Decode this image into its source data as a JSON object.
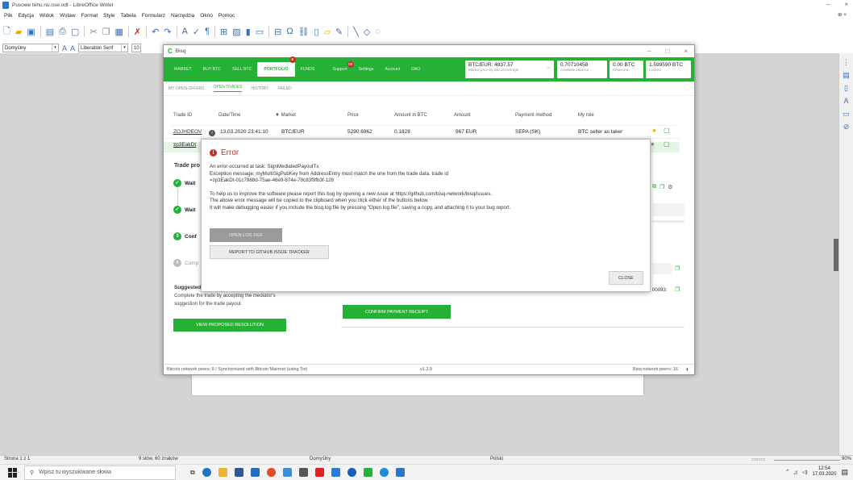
{
  "libreoffice": {
    "title": "Pusowe tehu.nu.ose.odt - LibreOffice Writer",
    "menu": [
      "Plik",
      "Edycja",
      "Widok",
      "Wstaw",
      "Format",
      "Style",
      "Tabela",
      "Formularz",
      "Narzędzia",
      "Okno",
      "Pomoc"
    ],
    "style_combo": "Domyślny",
    "font_combo": "Liberation Serif",
    "size_combo": "10",
    "status": {
      "page": "Strona 1 z 1",
      "words": "9 słów, 60 znaków",
      "style": "Domyślny",
      "lang": "Polski",
      "zoom": "90%"
    }
  },
  "taskbar": {
    "search_placeholder": "Wpisz tu wyszukiwane słowa",
    "time": "12:54",
    "date": "17.03.2020"
  },
  "bisq": {
    "title": "Bisq",
    "nav": [
      {
        "label": "MARKET"
      },
      {
        "label": "BUY BTC"
      },
      {
        "label": "SELL BTC"
      },
      {
        "label": "PORTFOLIO",
        "badge": "6"
      },
      {
        "label": "FUNDS"
      },
      {
        "label": "Support",
        "badge": "58"
      },
      {
        "label": "Settings"
      },
      {
        "label": "Account"
      },
      {
        "label": "DAO"
      }
    ],
    "price": {
      "value": "BTC/EUR: 4837.57",
      "sub": "Market price by BitcoinAverage"
    },
    "balances": [
      {
        "value": "0.70710458",
        "sub": "Available balance"
      },
      {
        "value": "0.00 BTC",
        "sub": "Reserved"
      },
      {
        "value": "1.599590 BTC",
        "sub": "Locked"
      }
    ],
    "subtabs": [
      "MY OPEN OFFERS",
      "OPEN TRADES",
      "HISTORY",
      "FAILED"
    ],
    "table_headers": [
      "Trade ID",
      "Date/Time",
      "▼ Market",
      "Price",
      "Amount in BTC",
      "Amount",
      "Payment method",
      "My role"
    ],
    "rows": [
      {
        "id": "ZOJHDEOV",
        "date": "13.03.2020 23:41:10",
        "market": "BTC/EUR",
        "price": "5290.6962",
        "amount_btc": "0.1828",
        "amount": "967 EUR",
        "method": "SEPA (SK)",
        "role": "BTC seller as taker"
      },
      {
        "id": "zp3EakDt"
      }
    ],
    "trade_process": "Trade pro",
    "steps": [
      {
        "label": "Wait",
        "num": ""
      },
      {
        "label": "Wait",
        "num": ""
      },
      {
        "label": "Conf",
        "num": "3"
      },
      {
        "label": "Comp",
        "num": "4"
      }
    ],
    "suggested_title": "Suggested",
    "suggested_text": [
      "Complete the trade by accepting the mediator's",
      "suggestion for the trade payout."
    ],
    "view_resolution": "VIEW PROPOSED RESOLUTION",
    "confirm_payment": "CONFIRM PAYMENT RECEIPT",
    "partial_value": "00093:",
    "status_left": "Bitcoin network peers: 9 / Synchronized with Bitcoin Mainnet (using Tor)",
    "status_version": "v1.2.9",
    "status_right": "Bisq network peers: 16"
  },
  "error": {
    "title": "Error",
    "lines": [
      "An error occurred at task: SignMediatedPayoutTx",
      "Exception message: myMultiSigPubKey from AddressEntry must match the one from the trade data. trade id",
      "=zp3EakDt-01c7988d-75ae-46e9-874e-79c83f9fb3f-128",
      "",
      "To help us to improve the software please report this bug by opening a new issue at https://github.com/bisq-network/bisq/issues.",
      "The above error message will be copied to the clipboard when you click either of the buttons below.",
      "It will make debugging easier if you include the bisq.log file by pressing \"Open log file\", saving a copy, and attaching it to your bug report."
    ],
    "open_log": "OPEN LOG FILE",
    "report": "REPORT TO GITHUB ISSUE TRACKER",
    "close": "CLOSE"
  }
}
